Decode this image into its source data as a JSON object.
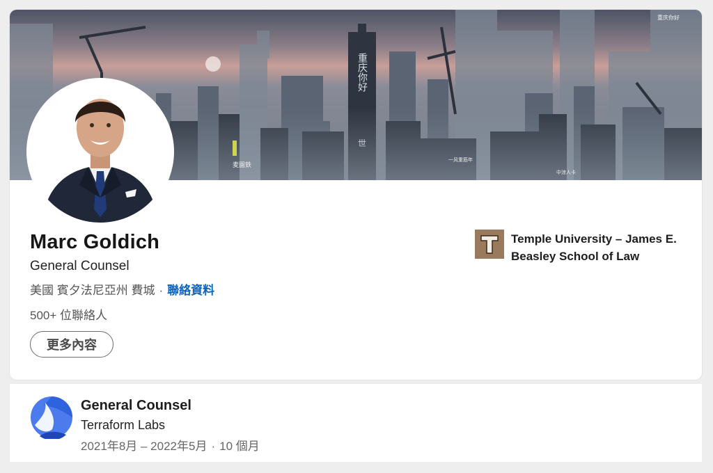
{
  "profile": {
    "name": "Marc Goldich",
    "headline": "General Counsel",
    "location": "美國 賓夕法尼亞州 費城",
    "separator": "·",
    "contact_info_label": "聯絡資料",
    "connections": "500+ 位聯絡人",
    "more_button_label": "更多內容"
  },
  "education": {
    "school_name": "Temple University – James E. Beasley School of Law"
  },
  "banner": {
    "signage": {
      "tower": "重庆你好",
      "tower_sub": "世",
      "top_right": "重庆你好",
      "shop": "麦園鉄",
      "bottom": "中涼人卡",
      "mid": "一风重筋年"
    }
  },
  "experience": {
    "title": "General Counsel",
    "company": "Terraform Labs",
    "date_range": "2021年8月 – 2022年5月",
    "separator": "·",
    "duration": "10 個月"
  },
  "colors": {
    "link": "#0a66c2",
    "terraform_logo_blue": "#4b7bec",
    "banner_sky_top": "#4e5666",
    "banner_sky_sunset": "#c79a96"
  }
}
